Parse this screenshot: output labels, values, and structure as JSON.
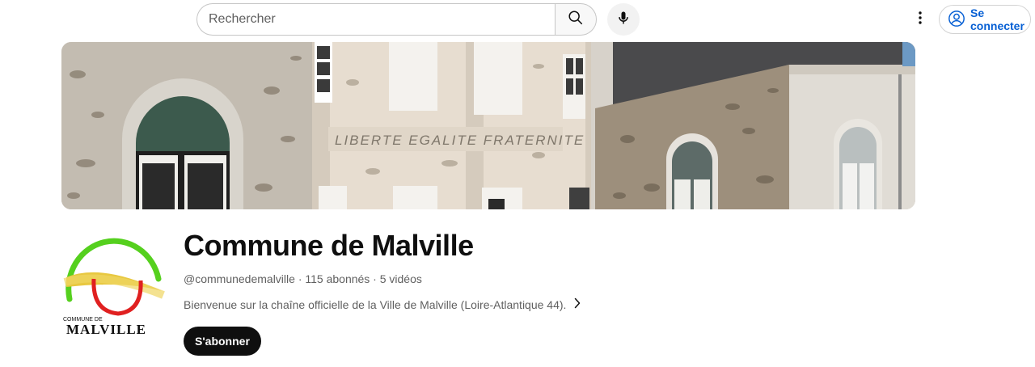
{
  "header": {
    "search_placeholder": "Rechercher",
    "search_icon": "search-icon",
    "mic_icon": "microphone-icon",
    "more_icon": "more-vertical-icon",
    "signin_label": "Se connecter",
    "signin_icon": "account-circle-icon",
    "accent_color": "#065fd4"
  },
  "channel": {
    "name": "Commune de Malville",
    "meta": "@communedemalville · 115 abonnés · 5 vidéos",
    "description": "Bienvenue sur la chaîne officielle de la Ville de Malville (Loire-Atlantique 44).",
    "description_icon": "chevron-right-icon",
    "subscribe_label": "S'abonner"
  },
  "banner": {
    "motto": "LIBERTE EGALITE FRATERNITE"
  },
  "avatar": {
    "logo_text_top": "COMMUNE DE",
    "logo_text_main": "MALVILLE"
  }
}
